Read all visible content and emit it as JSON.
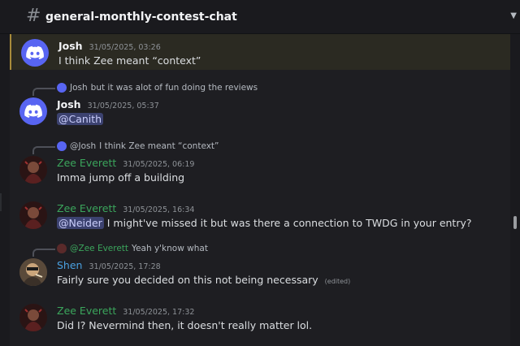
{
  "header": {
    "channel": "general-monthly-contest-chat"
  },
  "colors": {
    "josh": "#f2f3f5",
    "zee": "#3ba55c",
    "shen": "#4aa0e0",
    "mention_bg": "#3c4270"
  },
  "messages": [
    {
      "author": "Josh",
      "timestamp": "31/05/2025, 03:26",
      "text": "I think Zee meant “context”"
    },
    {
      "reply_author": "Josh",
      "reply_text": "but it was alot of fun doing the reviews",
      "author": "Josh",
      "timestamp": "31/05/2025, 05:37",
      "mention": "@Canith"
    },
    {
      "reply_author": "@Josh",
      "reply_text": "I think Zee meant “context”",
      "author": "Zee Everett",
      "timestamp": "31/05/2025, 06:19",
      "text": "Imma jump off a building"
    },
    {
      "author": "Zee Everett",
      "timestamp": "31/05/2025, 16:34",
      "mention": "@Neider",
      "text": "I might've missed it but was there a connection to TWDG in your entry?"
    },
    {
      "reply_author": "@Zee Everett",
      "reply_text": "Yeah y'know what",
      "author": "Shen",
      "timestamp": "31/05/2025, 17:28",
      "text": "Fairly sure you decided on this not being necessary",
      "edited": "(edited)"
    },
    {
      "author": "Zee Everett",
      "timestamp": "31/05/2025, 17:32",
      "text": "Did I? Nevermind then, it doesn't really matter lol."
    }
  ]
}
